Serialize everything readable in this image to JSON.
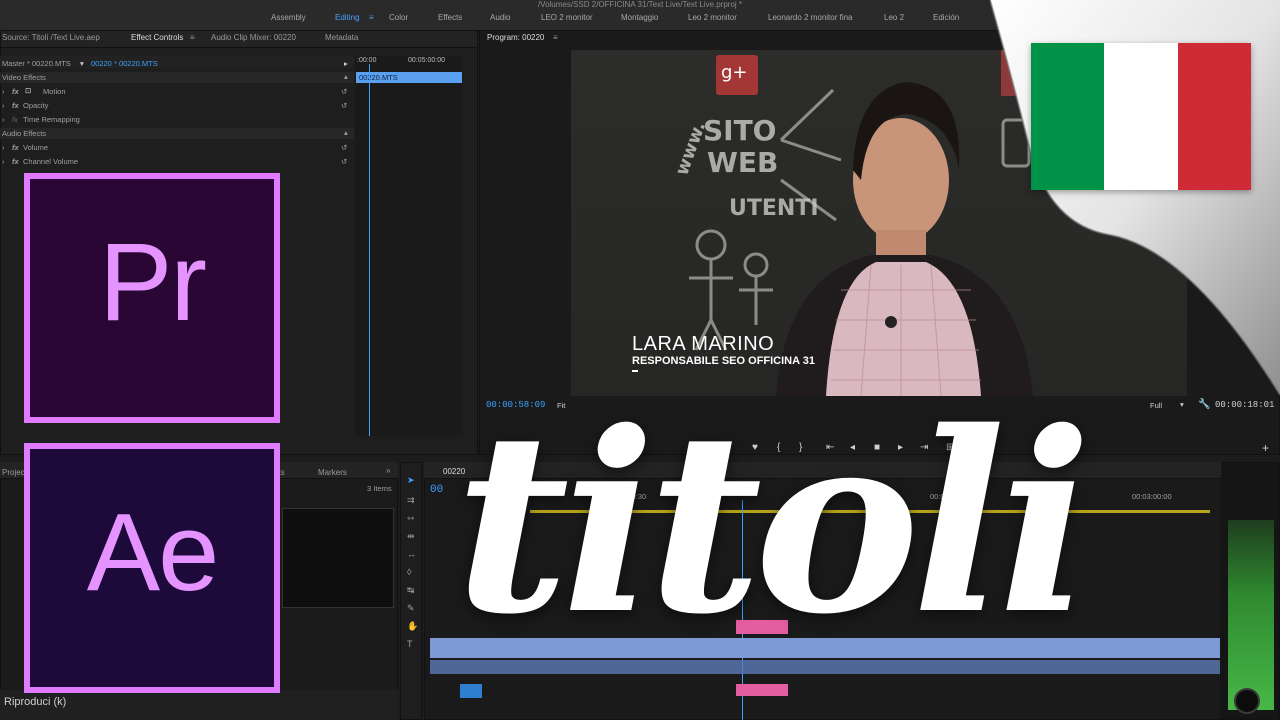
{
  "window": {
    "path": "/Volumes/SSD 2/OFFICINA 31/Text Live/Text Live.prproj *",
    "workspaces": [
      "Assembly",
      "Editing",
      "Color",
      "Effects",
      "Audio",
      "LEO 2 monitor",
      "Montaggio",
      "Leo 2 monitor",
      "Leonardo 2 monitor fina",
      "Leo 2",
      "Edición"
    ],
    "active_workspace": "Editing"
  },
  "source_panel": {
    "tabs": [
      "Source: Titoli /Text Live.aep",
      "Effect Controls",
      "Audio Clip Mixer: 00220",
      "Metadata"
    ],
    "active_tab": "Effect Controls",
    "master_label": "Master * 00220.MTS",
    "sequence_label": "00220 * 00220.MTS",
    "ruler_start": ":00:00",
    "ruler_end": "00:05:00:00",
    "clip_name": "00220.MTS",
    "sections": {
      "video": "Video Effects",
      "audio": "Audio Effects"
    },
    "effects": [
      "Motion",
      "Opacity",
      "Time Remapping",
      "Volume",
      "Channel Volume"
    ]
  },
  "program_monitor": {
    "title": "Program: 00220",
    "timecode_left": "00:00:58:09",
    "fit_label": "Fit",
    "quality_label": "Full",
    "timecode_right": "00:00:18:01",
    "chalkboard": [
      "SITO",
      "WEB",
      "UTENTI",
      "www."
    ],
    "lower_third_name": "LARA MARINO",
    "lower_third_role": "RESPONSABILE SEO OFFICINA 31"
  },
  "project_panel": {
    "tab": "Project",
    "tab2": "ects",
    "tab3": "Markers",
    "items_count": "3 Items",
    "play_label": "Riproduci (k)"
  },
  "timeline": {
    "tab": "00220",
    "timecode": "00",
    "ruler": [
      "00:00:30",
      "00:02:00:00",
      "00:02:3",
      "00:03:00:00"
    ]
  },
  "overlay": {
    "title_word": "titoli",
    "logo_pr": "Pr",
    "logo_ae": "Ae"
  },
  "colors": {
    "accent_blue": "#3fa0ff",
    "logo_purple": "#e07bff",
    "flag_green": "#009246",
    "flag_white": "#ffffff",
    "flag_red": "#ce2b37"
  }
}
